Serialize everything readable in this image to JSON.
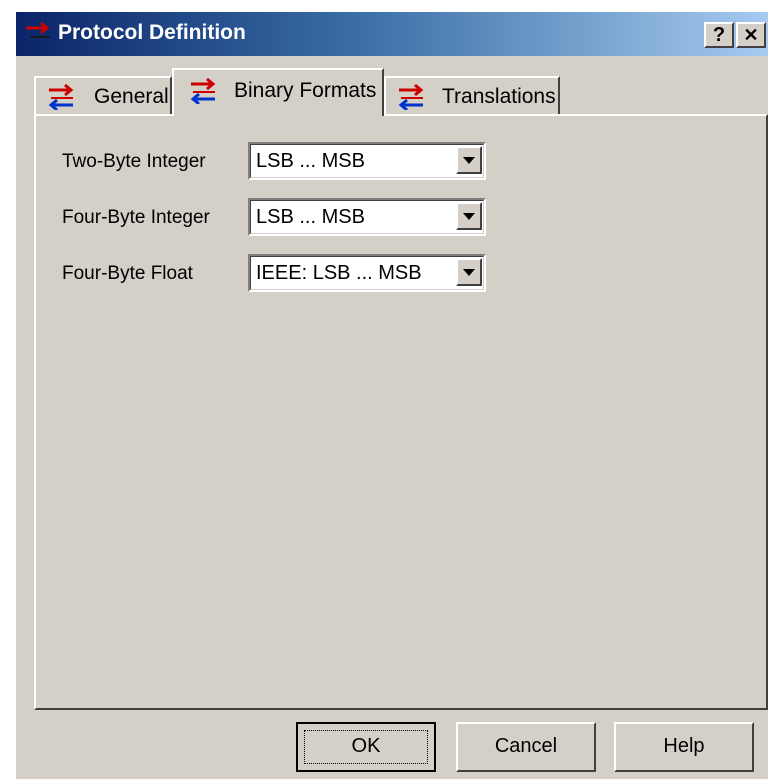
{
  "window": {
    "title": "Protocol Definition",
    "help_glyph": "?",
    "close_glyph": "✕",
    "icon": "protocol-arrows-icon"
  },
  "tabs": [
    {
      "label": "General",
      "icon": "exchange-arrows-icon",
      "selected": false
    },
    {
      "label": "Binary Formats",
      "icon": "exchange-arrows-icon",
      "selected": true
    },
    {
      "label": "Translations",
      "icon": "exchange-arrows-icon",
      "selected": false
    }
  ],
  "fields": [
    {
      "label": "Two-Byte Integer",
      "value": "LSB ... MSB"
    },
    {
      "label": "Four-Byte Integer",
      "value": "LSB ... MSB"
    },
    {
      "label": "Four-Byte Float",
      "value": "IEEE: LSB ... MSB"
    }
  ],
  "buttons": {
    "ok": "OK",
    "cancel": "Cancel",
    "help": "Help"
  },
  "colors": {
    "face": "#d4d0c8",
    "title_start": "#0a246a",
    "title_end": "#a6caf0",
    "arrow_red": "#cc0000",
    "arrow_blue": "#0033cc"
  }
}
